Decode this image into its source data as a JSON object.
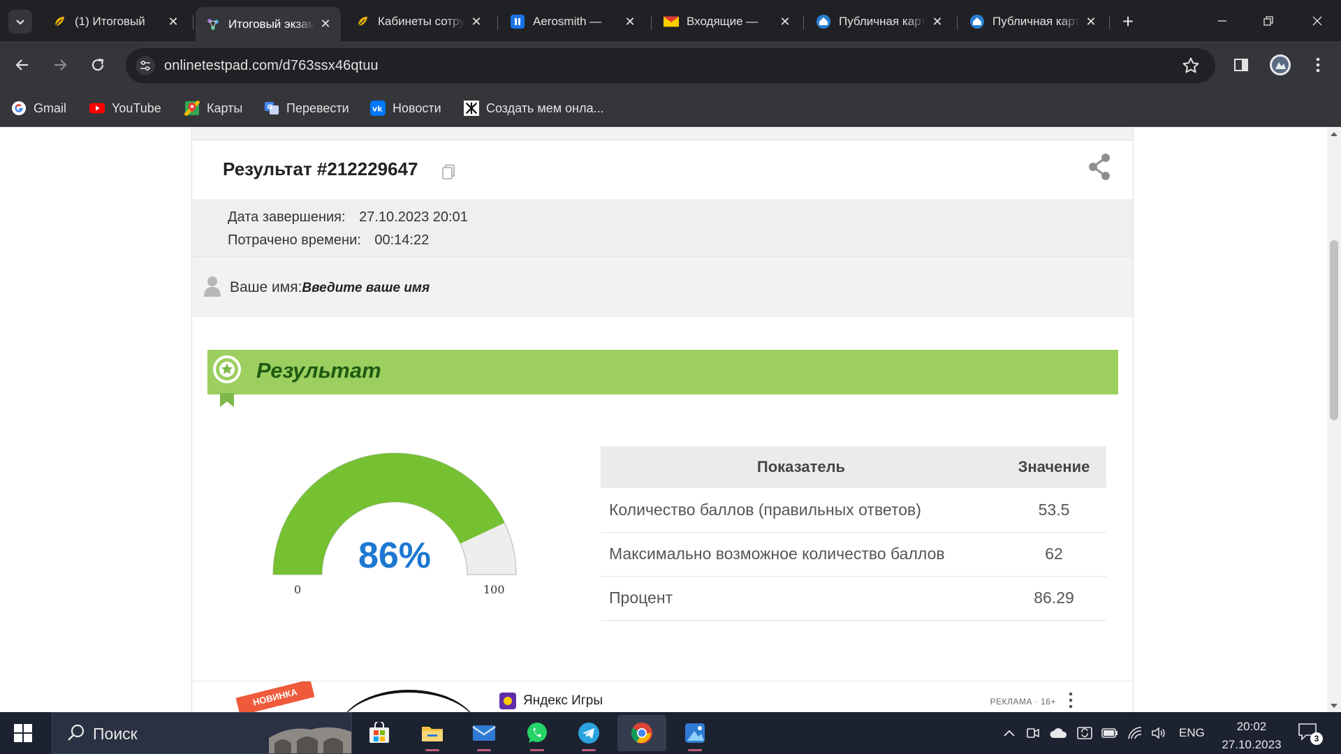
{
  "browser": {
    "tabs": [
      {
        "title": "(1) Итоговый",
        "icon": "yellow-leaf-icon",
        "active": false
      },
      {
        "title": "Итоговый экзамен",
        "icon": "molecule-icon",
        "active": true
      },
      {
        "title": "Кабинеты сотрудников",
        "icon": "yellow-leaf-icon",
        "active": false
      },
      {
        "title": "Aerosmith — ",
        "icon": "pause-icon",
        "active": false
      },
      {
        "title": "Входящие — ",
        "icon": "mail-icon",
        "active": false
      },
      {
        "title": "Публичная карта",
        "icon": "home-icon",
        "active": false
      },
      {
        "title": "Публичная карта",
        "icon": "home-icon",
        "active": false
      }
    ],
    "url": "onlinetestpad.com/d763ssx46qtuu",
    "bookmarks": [
      {
        "label": "Gmail",
        "icon": "google-icon"
      },
      {
        "label": "YouTube",
        "icon": "youtube-icon"
      },
      {
        "label": "Карты",
        "icon": "maps-icon"
      },
      {
        "label": "Перевести",
        "icon": "translate-icon"
      },
      {
        "label": "Новости",
        "icon": "vk-icon"
      },
      {
        "label": "Создать мем онла...",
        "icon": "meme-icon"
      }
    ]
  },
  "result": {
    "title": "Результат #212229647",
    "completion_label": "Дата завершения:",
    "completion_value": "27.10.2023 20:01",
    "time_label": "Потрачено времени:",
    "time_value": "00:14:22",
    "name_label": "Ваше имя:",
    "name_placeholder": "Введите ваше имя",
    "banner_title": "Результат",
    "gauge": {
      "percent": 86,
      "percent_text": "86%",
      "min_label": "0",
      "max_label": "100",
      "fill_color": "#76c132",
      "track_color": "#eeeeee",
      "text_color": "#1e78d2"
    },
    "table": {
      "headers": [
        "Показатель",
        "Значение"
      ],
      "rows": [
        {
          "name": "Количество баллов (правильных ответов)",
          "value": "53.5"
        },
        {
          "name": "Максимально возможное количество баллов",
          "value": "62"
        },
        {
          "name": "Процент",
          "value": "86.29"
        }
      ]
    }
  },
  "ad": {
    "promo_text": "НОВИНКА",
    "title": "Яндекс Игры",
    "label": "РЕКЛАМА · 16+"
  },
  "taskbar": {
    "search_placeholder": "Поиск",
    "apps": [
      "store-icon",
      "file-explorer-icon",
      "mail-app-icon",
      "whatsapp-icon",
      "telegram-icon",
      "chrome-icon",
      "paint-icon"
    ],
    "lang": "ENG",
    "time": "20:02",
    "date": "27.10.2023",
    "notifications": "3"
  }
}
